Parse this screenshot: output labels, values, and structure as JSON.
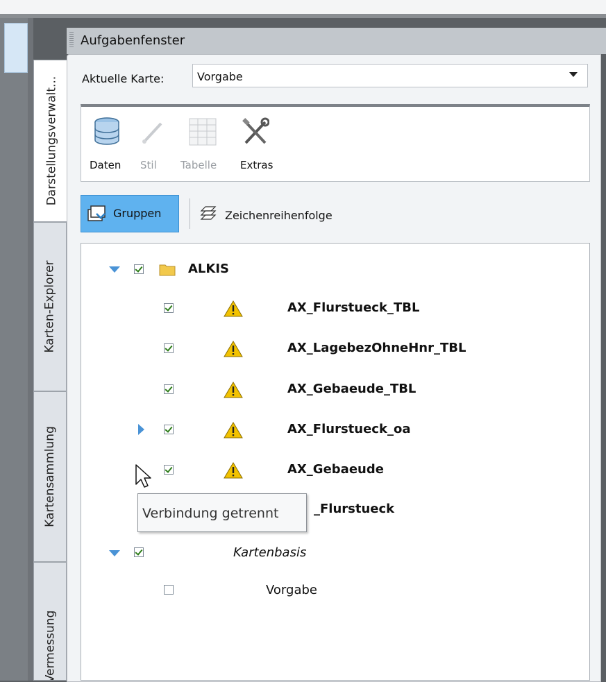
{
  "panel": {
    "title": "Aufgabenfenster"
  },
  "side_tabs": [
    "Darstellungsverwalt...",
    "Karten-Explorer",
    "Kartensammlung",
    "Vermessung"
  ],
  "current_map": {
    "label": "Aktuelle Karte:",
    "value": "Vorgabe"
  },
  "ribbon": {
    "daten": "Daten",
    "stil": "Stil",
    "tabelle": "Tabelle",
    "extras": "Extras"
  },
  "view_buttons": {
    "gruppen": "Gruppen",
    "zeichenreihenfolge": "Zeichenreihenfolge"
  },
  "tree": {
    "group": "ALKIS",
    "layers": [
      "AX_Flurstueck_TBL",
      "AX_LagebezOhneHnr_TBL",
      "AX_Gebaeude_TBL",
      "AX_Flurstueck_oa",
      "AX_Gebaeude",
      "_Flurstueck"
    ],
    "base_group": "Kartenbasis",
    "base_layer": "Vorgabe"
  },
  "tooltip": "Verbindung getrennt",
  "colors": {
    "accent": "#5fb2ef",
    "warning": "#f2c200",
    "expander": "#4a93d6"
  }
}
